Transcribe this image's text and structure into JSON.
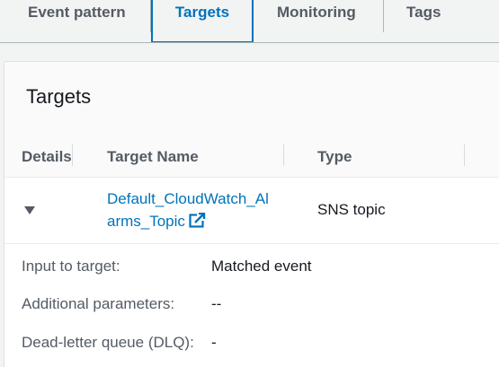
{
  "tabs": [
    {
      "label": "Event pattern"
    },
    {
      "label": "Targets"
    },
    {
      "label": "Monitoring"
    },
    {
      "label": "Tags"
    }
  ],
  "panel": {
    "title": "Targets",
    "columns": [
      "Details",
      "Target Name",
      "Type"
    ],
    "row": {
      "target_name_line1": "Default_CloudWatch_Al",
      "target_name_line2": "arms_Topic",
      "type": "SNS topic",
      "link_icon": "external-link-icon"
    },
    "details": [
      {
        "label": "Input to target:",
        "value": "Matched event"
      },
      {
        "label": "Additional parameters:",
        "value": "--"
      },
      {
        "label": "Dead-letter queue (DLQ):",
        "value": "-"
      }
    ]
  },
  "colors": {
    "accent": "#0073bb",
    "text": "#16191f",
    "muted": "#545b64",
    "background": "#f2f3f3"
  }
}
